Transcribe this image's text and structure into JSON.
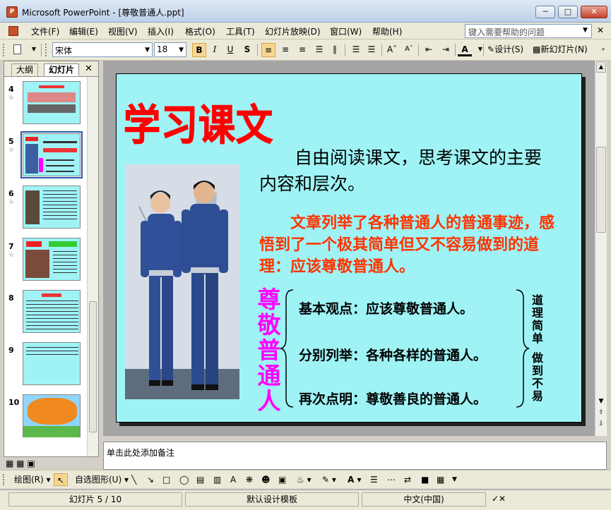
{
  "window": {
    "title": "Microsoft PowerPoint - [尊敬普通人.ppt]",
    "app_icon_label": "P"
  },
  "menu": {
    "items": [
      "文件(F)",
      "编辑(E)",
      "视图(V)",
      "插入(I)",
      "格式(O)",
      "工具(T)",
      "幻灯片放映(D)",
      "窗口(W)",
      "帮助(H)"
    ],
    "help_placeholder": "键入需要帮助的问题"
  },
  "toolbar": {
    "font_name": "宋体",
    "font_size": "18",
    "bold": "B",
    "italic": "I",
    "underline": "U",
    "shadow": "S",
    "design_label": "设计(S)",
    "new_slide_label": "新幻灯片(N)"
  },
  "left_pane": {
    "tabs": [
      "大纲",
      "幻灯片"
    ],
    "thumbnails": [
      {
        "num": "4",
        "star": "☆"
      },
      {
        "num": "5",
        "star": "☆"
      },
      {
        "num": "6",
        "star": "☆"
      },
      {
        "num": "7",
        "star": "☆"
      },
      {
        "num": "8",
        "star": ""
      },
      {
        "num": "9",
        "star": ""
      },
      {
        "num": "10",
        "star": ""
      }
    ],
    "selected": "5"
  },
  "slide": {
    "title": "学习课文",
    "para1": "自由阅读课文，思考课文的主要内容和层次。",
    "para2": "文章列举了各种普通人的普通事迹，感悟到了一个极其简单但又不容易做到的道理：应该尊敬普通人。",
    "vertical_label": "尊敬普通人",
    "points": [
      "基本观点：应该尊敬普通人。",
      "分别列举：各种各样的普通人。",
      "再次点明：尊敬善良的普通人。"
    ],
    "right_label_top": "道理简单",
    "right_label_bottom": "做到不易",
    "colors": {
      "background": "#9ff3f5",
      "title": "#ff0000",
      "highlight": "#ff3300",
      "vertical": "#ff00ff"
    }
  },
  "notes": {
    "placeholder": "单击此处添加备注"
  },
  "drawing": {
    "draw_label": "绘图(R)",
    "autoshape_label": "自选图形(U)"
  },
  "status": {
    "slide_pos": "幻灯片 5 / 10",
    "template": "默认设计模板",
    "language": "中文(中国)"
  }
}
